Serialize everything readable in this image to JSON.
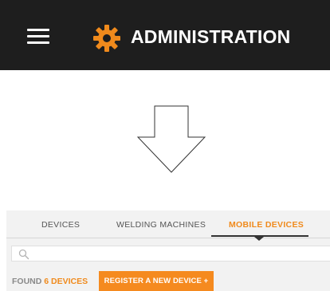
{
  "header": {
    "title": "ADMINISTRATION",
    "menu_icon": "hamburger-menu-icon",
    "logo_icon": "gear-icon",
    "background_color": "#1e1e1e",
    "accent_color": "#f08a1c"
  },
  "illustration": {
    "icon": "down-arrow-icon"
  },
  "tabs": [
    {
      "label": "DEVICES",
      "active": false
    },
    {
      "label": "WELDING MACHINES",
      "active": false
    },
    {
      "label": "MOBILE DEVICES",
      "active": true
    }
  ],
  "search": {
    "icon": "search-icon",
    "placeholder": "",
    "value": ""
  },
  "results": {
    "found_label": "FOUND",
    "count_text": "6 DEVICES"
  },
  "actions": {
    "register_label": "REGISTER A NEW DEVICE +"
  }
}
